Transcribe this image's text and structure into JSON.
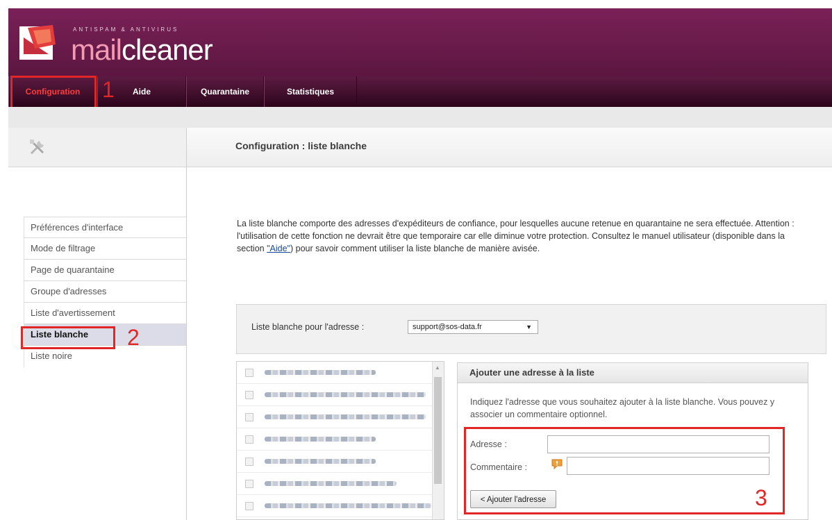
{
  "header": {
    "tagline": "ANTISPAM & ANTIVIRUS",
    "brand_prefix": "mail",
    "brand_suffix": "cleaner"
  },
  "nav": {
    "items": [
      "Configuration",
      "Aide",
      "Quarantaine",
      "Statistiques"
    ],
    "active": "Configuration"
  },
  "annotations": [
    "1",
    "2",
    "3"
  ],
  "page": {
    "title": "Configuration : liste blanche"
  },
  "sidebar": {
    "items": [
      "Préférences d'interface",
      "Mode de filtrage",
      "Page de quarantaine",
      "Groupe d'adresses",
      "Liste d'avertissement",
      "Liste blanche",
      "Liste noire"
    ],
    "active": "Liste blanche"
  },
  "intro": {
    "text_before_link": "La liste blanche comporte des adresses d'expéditeurs de confiance, pour lesquelles aucune retenue en quarantaine ne sera effectuée. Attention : l'utilisation de cette fonction ne devrait être que temporaire car elle diminue votre protection. Consultez le manuel utilisateur (disponible dans la section ",
    "link_text": "\"Aide\"",
    "text_after_link": ") pour savoir comment utiliser la liste blanche de manière avisée."
  },
  "address_selector": {
    "label": "Liste blanche pour l'adresse :",
    "selected": "support@sos-data.fr"
  },
  "add_form": {
    "heading": "Ajouter une adresse à la liste",
    "description": "Indiquez l'adresse que vous souhaitez ajouter à la liste blanche. Vous pouvez y associer un commentaire optionnel.",
    "address_label": "Adresse :",
    "address_value": "",
    "comment_label": "Commentaire :",
    "comment_value": "",
    "submit_label": "< Ajouter l'adresse"
  },
  "colors": {
    "brand": "#5c1640",
    "highlight": "#e12626",
    "link": "#1a4a9c"
  }
}
